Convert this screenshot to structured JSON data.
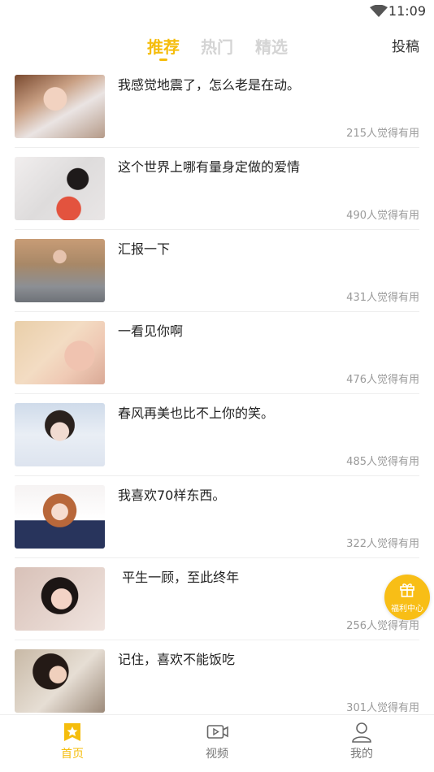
{
  "status_bar": {
    "time": "11:09",
    "icons": [
      "wifi-icon"
    ]
  },
  "header": {
    "tabs": [
      {
        "label": "推荐",
        "active": true
      },
      {
        "label": "热门",
        "active": false
      },
      {
        "label": "精选",
        "active": false
      }
    ],
    "post_button": "投稿"
  },
  "posts": [
    {
      "title": "我感觉地震了，怎么老是在动。",
      "likes": "215人觉得有用"
    },
    {
      "title": "这个世界上哪有量身定做的爱情",
      "likes": "490人觉得有用"
    },
    {
      "title": "汇报一下",
      "likes": "431人觉得有用"
    },
    {
      "title": "一看见你啊",
      "likes": "476人觉得有用"
    },
    {
      "title": "春风再美也比不上你的笑。",
      "likes": "485人觉得有用"
    },
    {
      "title": "我喜欢70样东西。",
      "likes": "322人觉得有用"
    },
    {
      "title": " 平生一顾，至此终年",
      "likes": "256人觉得有用"
    },
    {
      "title": "记住，喜欢不能饭吃",
      "likes": "301人觉得有用"
    }
  ],
  "welfare_button": {
    "label": "福利中心",
    "icon": "gift-icon"
  },
  "bottom_nav": [
    {
      "label": "首页",
      "icon": "home-star-icon",
      "active": true
    },
    {
      "label": "视频",
      "icon": "video-icon",
      "active": false
    },
    {
      "label": "我的",
      "icon": "user-icon",
      "active": false
    }
  ],
  "colors": {
    "accent": "#f5bd0c",
    "inactive_tab": "#d4d4d4",
    "meta_text": "#9a9a9a"
  }
}
